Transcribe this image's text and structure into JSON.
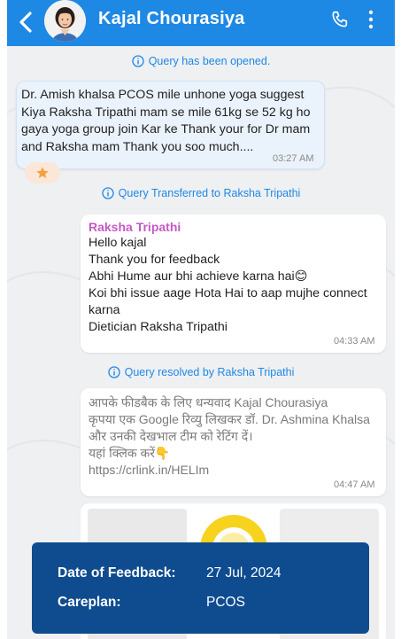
{
  "header": {
    "contact_name": "Kajal Chourasiya",
    "color": "#1e88e5"
  },
  "system_notes": {
    "opened": "Query has been opened.",
    "transferred": "Query Transferred to Raksha Tripathi",
    "resolved": "Query resolved by Raksha Tripathi"
  },
  "messages": {
    "incoming": {
      "lines": [
        "Dr. Amish khalsa PCOS mile unhone yoga suggest",
        "Kiya Raksha Tripathi mam se mile 61kg se 52 kg ho",
        "gaya yoga group join Kar ke Thank your for Dr mam",
        "and Raksha mam Thank you soo much...."
      ],
      "time": "03:27 AM",
      "reaction_icon": "star-icon"
    },
    "reply": {
      "sender": "Raksha Tripathi",
      "lines": [
        "Hello kajal",
        "Thank you for feedback",
        "Abhi Hume aur bhi achieve karna hai😊",
        "Koi bhi issue aage Hota Hai to aap mujhe connect",
        "karna",
        "Dietician Raksha Tripathi"
      ],
      "time": "04:33 AM"
    },
    "auto": {
      "lines": [
        "आपके फीडबैक के लिए धन्यवाद Kajal Chourasiya",
        "कृपया एक Google रिव्यु लिखकर डॉ. Dr. Ashmina Khalsa",
        "और उनकी देखभाल टीम को रेटिंग दें।",
        "यहां क्लिक करें👇",
        "https://crlink.in/HELIm"
      ],
      "time": "04:47 AM"
    }
  },
  "feedback_card": {
    "date_label": "Date of Feedback:",
    "date_value": "27 Jul, 2024",
    "careplan_label": "Careplan:",
    "careplan_value": "PCOS"
  }
}
